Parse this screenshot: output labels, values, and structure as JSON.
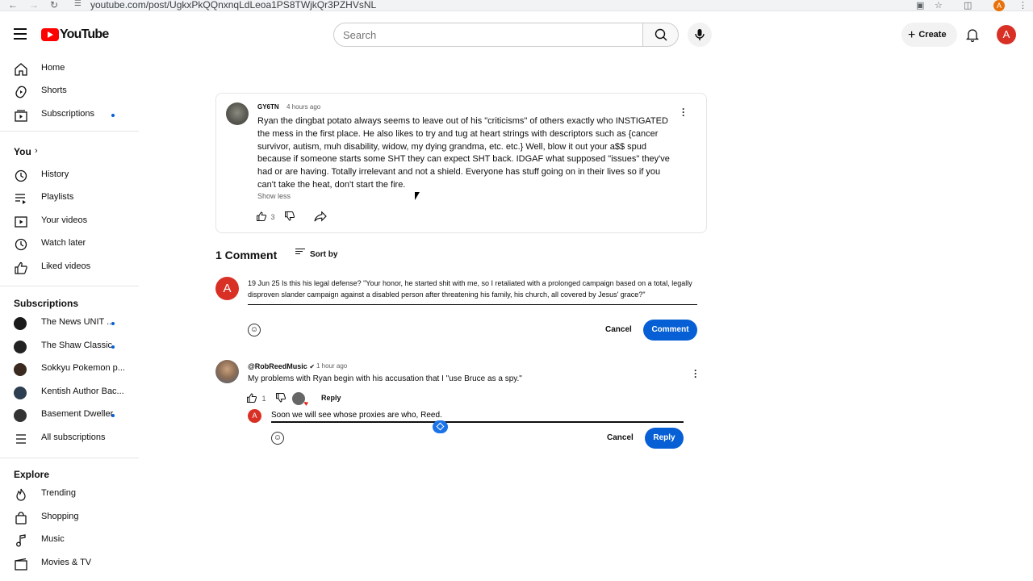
{
  "browser": {
    "url": "youtube.com/post/UgkxPkQQnxnqLdLeoa1PS8TWjkQr3PZHVsNL",
    "profile_initial": "A"
  },
  "masthead": {
    "logo_text": "YouTube",
    "search_placeholder": "Search",
    "create_label": "Create",
    "avatar_initial": "A",
    "brand_color": "#ff0000"
  },
  "sidebar": {
    "main": [
      {
        "label": "Home",
        "icon": "home-icon"
      },
      {
        "label": "Shorts",
        "icon": "shorts-icon"
      },
      {
        "label": "Subscriptions",
        "icon": "subscriptions-icon",
        "new_dot": true
      }
    ],
    "you_heading": "You",
    "you": [
      {
        "label": "History",
        "icon": "history-icon"
      },
      {
        "label": "Playlists",
        "icon": "playlists-icon"
      },
      {
        "label": "Your videos",
        "icon": "your-videos-icon"
      },
      {
        "label": "Watch later",
        "icon": "watch-later-icon"
      },
      {
        "label": "Liked videos",
        "icon": "liked-videos-icon"
      }
    ],
    "subscriptions_heading": "Subscriptions",
    "subscriptions": [
      {
        "label": "The News UNIT ...",
        "new_dot": true,
        "color": "#1a1a1a"
      },
      {
        "label": "The Shaw Classic",
        "new_dot": true,
        "color": "#222222"
      },
      {
        "label": "Sokkyu Pokemon p...",
        "new_dot": false,
        "color": "#3a2a1f"
      },
      {
        "label": "Kentish Author Bac...",
        "new_dot": false,
        "color": "#2d3e50"
      },
      {
        "label": "Basement Dweller",
        "new_dot": true,
        "color": "#333333"
      }
    ],
    "all_subscriptions": "All subscriptions",
    "explore_heading": "Explore",
    "explore": [
      {
        "label": "Trending",
        "icon": "trending-icon"
      },
      {
        "label": "Shopping",
        "icon": "shopping-icon"
      },
      {
        "label": "Music",
        "icon": "music-icon"
      },
      {
        "label": "Movies & TV",
        "icon": "movies-icon"
      }
    ]
  },
  "post": {
    "author": "GY6TN",
    "time": "4 hours ago",
    "body": "Ryan the dingbat potato always seems to leave out of his \"criticisms\" of others exactly who INSTIGATED the mess in the first place. He also likes to try and tug at heart strings with descriptors such as {cancer survivor, autism, muh disability, widow, my dying grandma, etc. etc.} Well, blow it out your a$$ spud because if someone starts some SHT they can expect SHT back. IDGAF what supposed \"issues\" they've had or are having. Totally irrelevant and not a shield. Everyone has stuff going on in their lives so if you can't take the heat, don't start the fire.",
    "show_less": "Show less",
    "like_count": "3"
  },
  "comments": {
    "count_label": "1 Comment",
    "sort_label": "Sort by",
    "draft": {
      "avatar_initial": "A",
      "text": "19 Jun 25 Is this his legal defense? \"Your honor, he started shit with me, so I retaliated with a prolonged campaign based on a total, legally disproven slander campaign against a disabled person after threatening his family, his church, all covered by Jesus' grace?\"",
      "cancel_label": "Cancel",
      "submit_label": "Comment"
    },
    "thread": {
      "author": "@RobReedMusic",
      "verified_mark": "✔",
      "time": "1 hour ago",
      "text": "My problems with Ryan begin with his accusation that I \"use Bruce as a spy.\"",
      "like_count": "1",
      "reply_label": "Reply",
      "reply_box": {
        "avatar_initial": "A",
        "value": "Soon we will see whose proxies are who, Reed.",
        "cancel_label": "Cancel",
        "submit_label": "Reply"
      }
    }
  }
}
